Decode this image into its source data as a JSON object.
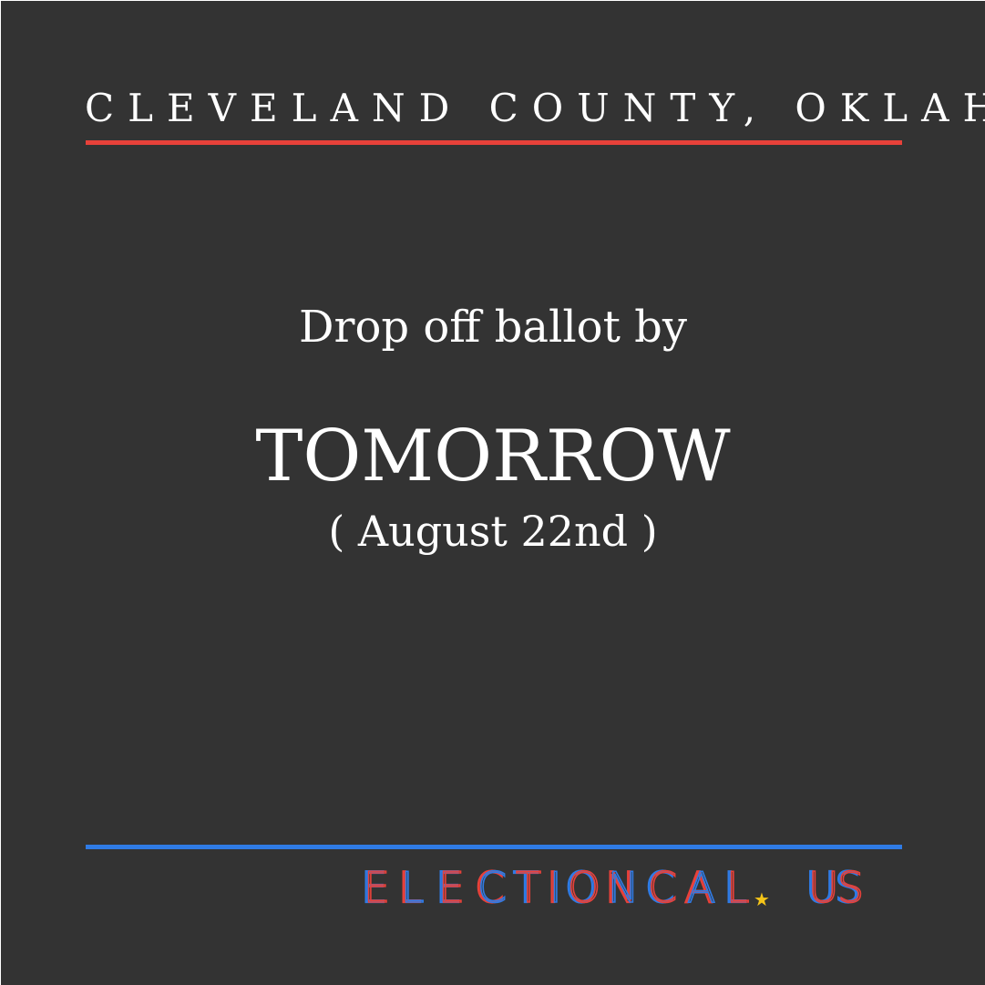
{
  "header": {
    "county": "CLEVELAND COUNTY, OKLAHOMA"
  },
  "main": {
    "lead": "Drop off ballot by",
    "deadline": "TOMORROW",
    "date": "( August 22nd )"
  },
  "footer": {
    "brand": "ELECTIONCAL.US",
    "brand_colors": {
      "red": "#e8413a",
      "blue": "#2f7be5",
      "star": "#f5c518"
    }
  },
  "colors": {
    "background": "#333333",
    "top_rule": "#e8413a",
    "bottom_rule": "#2f7be5",
    "text": "#ffffff"
  }
}
